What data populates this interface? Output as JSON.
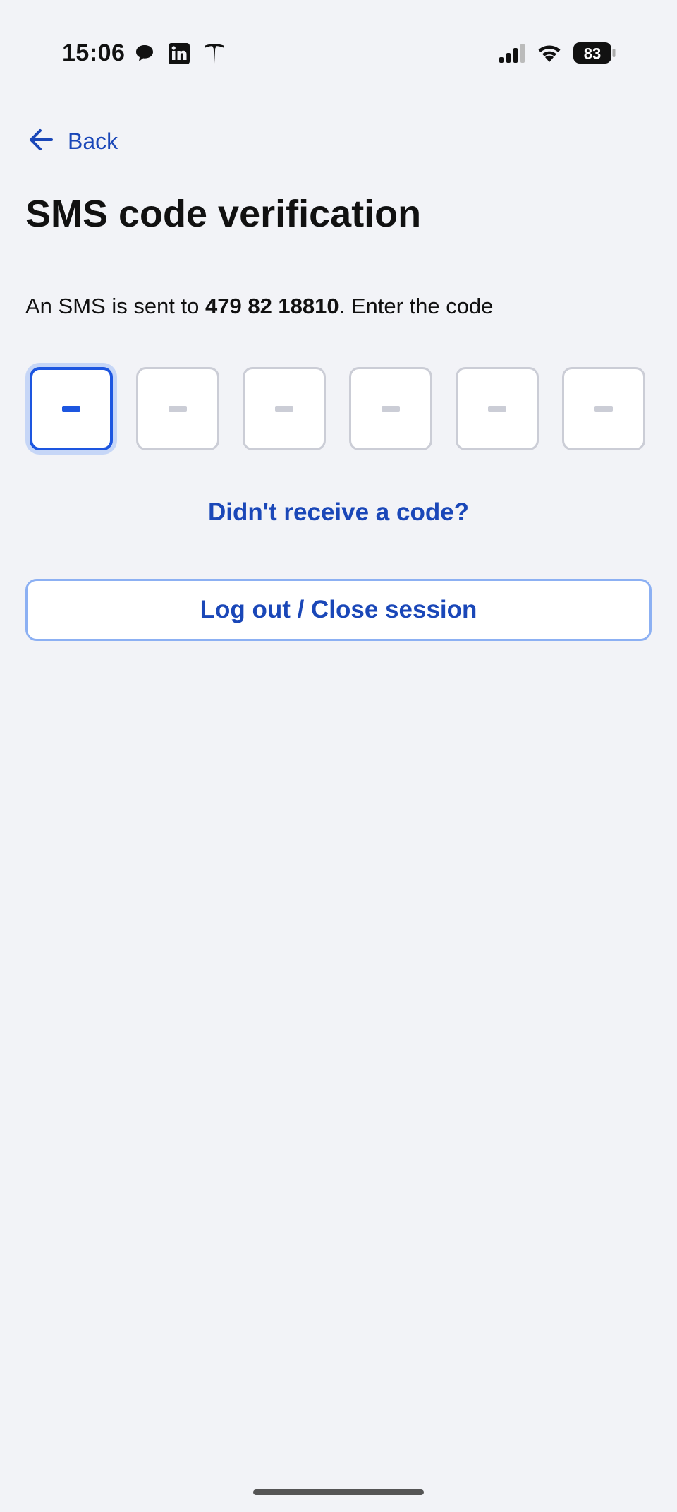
{
  "status_bar": {
    "time": "15:06",
    "battery": "83",
    "notification_icons": [
      "chat-bubble-icon",
      "linkedin-icon",
      "tesla-icon"
    ],
    "system_icons": [
      "signal-icon",
      "wifi-icon",
      "battery-icon"
    ]
  },
  "header": {
    "back_label": "Back",
    "title": "SMS code verification"
  },
  "message": {
    "prefix": "An SMS is sent to ",
    "phone": "479 82 18810",
    "suffix": ". Enter the code"
  },
  "code_input": {
    "length": 6,
    "active_index": 0,
    "placeholder": "-"
  },
  "actions": {
    "resend_label": "Didn't receive a code?",
    "logout_label": "Log out / Close session"
  },
  "colors": {
    "accent": "#1a47b8",
    "active_border": "#1d56e0",
    "background": "#f2f3f7"
  }
}
